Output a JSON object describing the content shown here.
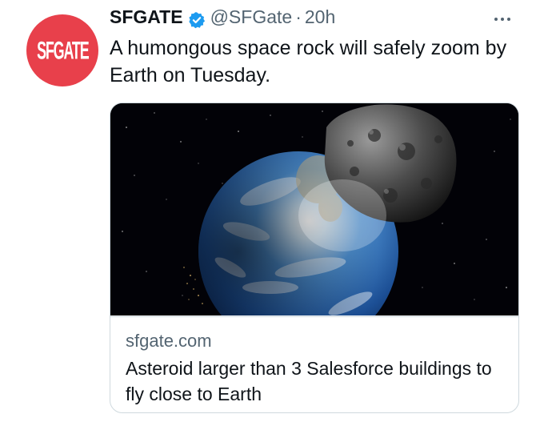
{
  "tweet": {
    "avatar": {
      "logo_text": "SFGATE",
      "color": "#e8404b"
    },
    "display_name": "SFGATE",
    "handle": "@SFGate",
    "separator": "·",
    "timestamp": "20h",
    "verified_icon": "verified-badge-icon",
    "more_icon": "more-options-icon",
    "text": "A humongous space rock will safely zoom by Earth on Tuesday."
  },
  "card": {
    "image_icon": "asteroid-earth-image",
    "domain": "sfgate.com",
    "title": "Asteroid larger than 3 Salesforce buildings to fly close to Earth"
  },
  "colors": {
    "text_primary": "#0f1419",
    "text_secondary": "#536471",
    "verified_blue": "#1d9bf0",
    "border": "#cfd9de"
  }
}
